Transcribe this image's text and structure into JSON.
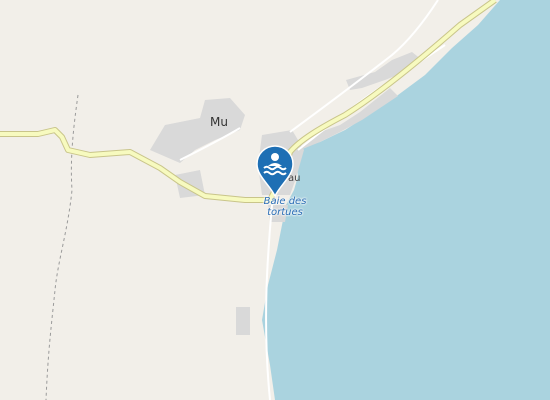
{
  "map": {
    "colors": {
      "land": "#f2efe9",
      "water": "#aad3df",
      "road_fill": "#f7fabf",
      "road_casing": "#c9c58a",
      "built_area": "#d9d9d9",
      "marker": "#1e6fb4"
    },
    "labels": {
      "village": "Mu",
      "hamlet": "au",
      "poi": "Baie des tortues"
    },
    "marker": {
      "icon": "swimming-icon",
      "category": "beach"
    }
  }
}
